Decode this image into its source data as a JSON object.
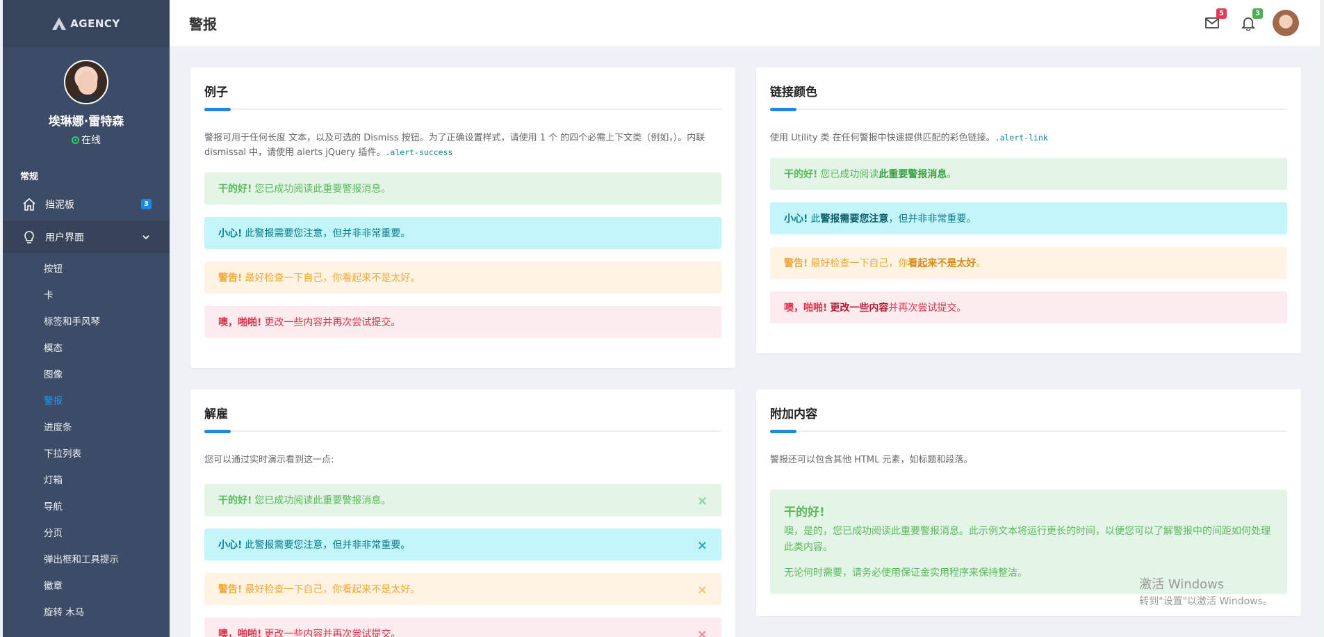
{
  "sidebar": {
    "logo": "AGENCY",
    "user_name": "埃琳娜·雷特森",
    "user_status": "在线",
    "section_label": "常规",
    "dashboard": {
      "label": "挡泥板",
      "badge": "3"
    },
    "ui": {
      "label": "用户界面"
    },
    "sub_items": [
      "按钮",
      "卡",
      "标签和手风琴",
      "模态",
      "图像",
      "警报",
      "进度条",
      "下拉列表",
      "灯箱",
      "导航",
      "分页",
      "弹出框和工具提示",
      "徽章",
      "旋转 木马"
    ]
  },
  "header": {
    "title": "警报",
    "mail_badge": "5",
    "bell_badge": "3"
  },
  "cards": {
    "examples": {
      "title": "例子",
      "desc": "警报可用于任何长度 文本，以及可选的 Dismiss 按钮。为了正确设置样式，请使用 1 个 的四个必需上下文类（例如，）。内联 dismissal 中，请使用 alerts jQuery 插件。",
      "code": ".alert-success",
      "alerts": [
        {
          "strong": "干的好!",
          "text": "您已成功阅读此重要警报消息。"
        },
        {
          "strong": "小心!",
          "text": "此警报需要您注意，但并非非常重要。"
        },
        {
          "strong": "警告!",
          "text": "最好检查一下自己，你看起来不是太好。"
        },
        {
          "strong": "噢，啪啪!",
          "text": "更改一些内容并再次尝试提交。"
        }
      ]
    },
    "links": {
      "title": "链接颜色",
      "desc": "使用 Utility 类 在任何警报中快速提供匹配的彩色链接。",
      "code": ".alert-link",
      "alerts": [
        {
          "strong": "干的好!",
          "pre": "您已成功阅读",
          "link": "此重要警报消息",
          "post": "。"
        },
        {
          "strong": "小心!",
          "pre": "此",
          "link": "警报需要您注意",
          "post": "，但并非非常重要。"
        },
        {
          "strong": "警告!",
          "pre": "最好检查一下自己，你",
          "link": "看起来不是太好",
          "post": "。"
        },
        {
          "strong": "噢，啪啪!",
          "pre": "",
          "link": "更改一些内容",
          "post": "并再次尝试提交。"
        }
      ]
    },
    "dismiss": {
      "title": "解雇",
      "desc": "您可以通过实时演示看到这一点:",
      "close": "×",
      "alerts": [
        {
          "strong": "干的好!",
          "text": "您已成功阅读此重要警报消息。"
        },
        {
          "strong": "小心!",
          "text": "此警报需要您注意，但并非非常重要。"
        },
        {
          "strong": "警告!",
          "text": "最好检查一下自己，你看起来不是太好。"
        },
        {
          "strong": "噢，啪啪!",
          "text": "更改一些内容并再次尝试提交。"
        }
      ]
    },
    "additional": {
      "title": "附加内容",
      "desc": "警报还可以包含其他 HTML 元素，如标题和段落。",
      "heading": "干的好!",
      "p1": "噢，是的，您已成功阅读此重要警报消息。此示例文本将运行更长的时间，以便您可以了解警报中的间距如何处理此类内容。",
      "p2": "无论何时需要，请务必使用保证金实用程序来保持整洁。"
    }
  },
  "watermark": {
    "line1": "激活 Windows",
    "line2": "转到\"设置\"以激活 Windows。"
  },
  "colors": {
    "sidebar": "#3d4c66",
    "accent": "#1e88e5",
    "success": "#5cb85c",
    "danger_badge": "#e53950",
    "success_badge": "#4caf50"
  }
}
